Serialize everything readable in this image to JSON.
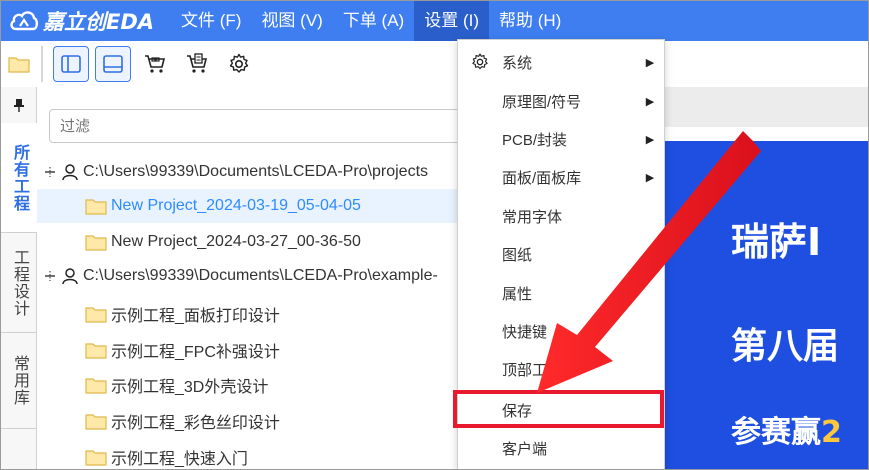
{
  "app": {
    "logo_text": "嘉立创EDA"
  },
  "menubar": {
    "items": [
      {
        "label": "文件 (F)"
      },
      {
        "label": "视图 (V)"
      },
      {
        "label": "下单 (A)"
      },
      {
        "label": "设置 (I)"
      },
      {
        "label": "帮助 (H)"
      }
    ],
    "active_index": 3
  },
  "toolbar": {
    "icons": [
      "folder-icon",
      "panel-left-icon",
      "panel-bottom-icon",
      "cart-icon",
      "order-icon",
      "gear-icon"
    ]
  },
  "side_tabs": {
    "items": [
      {
        "label": "所有工程"
      },
      {
        "label": "工程设计"
      },
      {
        "label": "常用库"
      }
    ],
    "active_index": 0
  },
  "project_panel": {
    "filter_placeholder": "过滤",
    "rows": [
      {
        "label": "C:\\Users\\99339\\Documents\\LCEDA-Pro\\projects",
        "type": "root"
      },
      {
        "label": "New Project_2024-03-19_05-04-05",
        "type": "folder",
        "selected": true
      },
      {
        "label": "New Project_2024-03-27_00-36-50",
        "type": "folder"
      },
      {
        "label": "C:\\Users\\99339\\Documents\\LCEDA-Pro\\example-",
        "type": "root"
      },
      {
        "label": "示例工程_面板打印设计",
        "type": "folder"
      },
      {
        "label": "示例工程_FPC补强设计",
        "type": "folder"
      },
      {
        "label": "示例工程_3D外壳设计",
        "type": "folder"
      },
      {
        "label": "示例工程_彩色丝印设计",
        "type": "folder"
      },
      {
        "label": "示例工程_快速入门",
        "type": "folder"
      }
    ]
  },
  "settings_menu": {
    "items": [
      {
        "label": "系统",
        "icon": "gear-icon",
        "submenu": true
      },
      {
        "label": "原理图/符号",
        "submenu": true
      },
      {
        "label": "PCB/封装",
        "submenu": true
      },
      {
        "label": "面板/面板库",
        "submenu": true
      },
      {
        "label": "常用字体",
        "submenu": false
      },
      {
        "label": "图纸",
        "submenu": false
      },
      {
        "label": "属性",
        "submenu": false
      },
      {
        "label": "快捷键",
        "submenu": false
      },
      {
        "label": "顶部工",
        "submenu": false
      },
      {
        "label": "保存",
        "submenu": false,
        "highlighted": true
      },
      {
        "label": "客户端",
        "submenu": false
      }
    ]
  },
  "banner": {
    "line1": "瑞萨I",
    "line2": "第八届",
    "line3": "参赛赢",
    "line3_accent": "2",
    "nav_arrow": "‹"
  },
  "colors": {
    "menubar": "#3e7ef0",
    "menu_active": "#2a5fcb",
    "selected_row_bg": "#e8f3ff",
    "selected_row_text": "#2f8bff",
    "banner_bg": "#1f4fe0",
    "highlight_red": "#e8192c",
    "folder_fill": "#ffe9a8",
    "folder_stroke": "#e0b84a"
  }
}
